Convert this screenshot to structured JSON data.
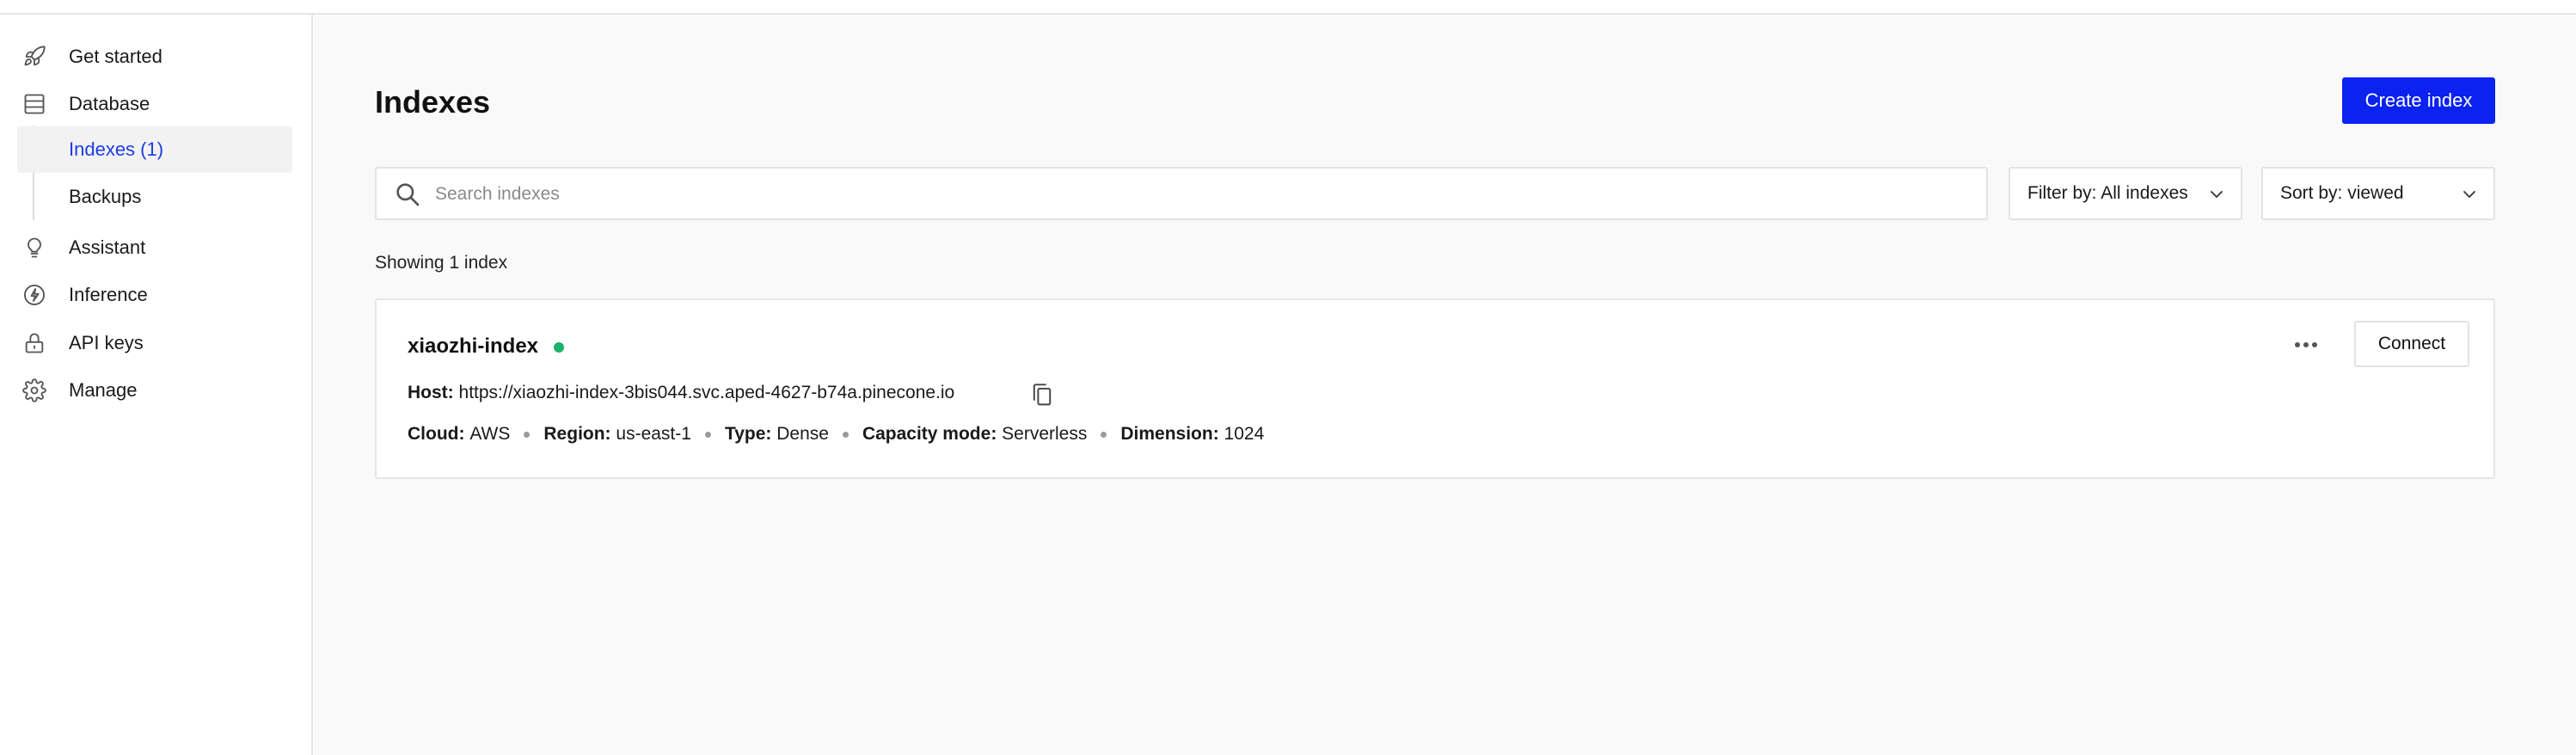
{
  "sidebar": {
    "items": [
      {
        "label": "Get started",
        "icon": "rocket-icon"
      },
      {
        "label": "Database",
        "icon": "database-icon"
      },
      {
        "label": "Assistant",
        "icon": "lightbulb-icon"
      },
      {
        "label": "Inference",
        "icon": "bolt-icon"
      },
      {
        "label": "API keys",
        "icon": "lock-icon"
      },
      {
        "label": "Manage",
        "icon": "gear-icon"
      }
    ],
    "database_sub": [
      {
        "label": "Indexes (1)",
        "active": true
      },
      {
        "label": "Backups",
        "active": false
      }
    ]
  },
  "main": {
    "title": "Indexes",
    "create_button": "Create index",
    "search": {
      "placeholder": "Search indexes",
      "value": ""
    },
    "filter_label": "Filter by: All indexes",
    "sort_label": "Sort by: viewed",
    "showing_text": "Showing 1 index"
  },
  "index_card": {
    "name": "xiaozhi-index",
    "status_color": "#1cb26a",
    "host_label": "Host:",
    "host_value": "https://xiaozhi-index-3bis044.svc.aped-4627-b74a.pinecone.io",
    "cloud_label": "Cloud:",
    "cloud_value": "AWS",
    "region_label": "Region:",
    "region_value": "us-east-1",
    "type_label": "Type:",
    "type_value": "Dense",
    "capacity_label": "Capacity mode:",
    "capacity_value": "Serverless",
    "dimension_label": "Dimension:",
    "dimension_value": "1024",
    "connect_button": "Connect",
    "more_icon": "more-horizontal-icon",
    "copy_icon": "copy-icon"
  },
  "colors": {
    "accent": "#0b22f0",
    "active_link": "#1d3ce8"
  }
}
